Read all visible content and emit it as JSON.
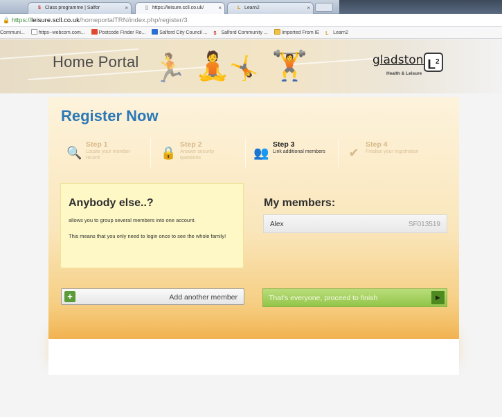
{
  "browser": {
    "tabs": [
      {
        "label": "Class programme | Salfor",
        "icon": "dollar-icon"
      },
      {
        "label": "https://leisure.scll.co.uk/",
        "icon": "page-icon",
        "active": true
      },
      {
        "label": "Learn2",
        "icon": "l2-icon"
      }
    ],
    "address": {
      "scheme": "https://",
      "host": "leisure.scll.co.uk",
      "path": "/homeportalTRN/index.php/register/3"
    },
    "bookmarks": [
      {
        "label": "Communi...",
        "icon": "page-icon"
      },
      {
        "label": "https--webcom.com...",
        "icon": "page-icon"
      },
      {
        "label": "Postcode Finder Ro...",
        "icon": "red-icon"
      },
      {
        "label": "Salford City Council ...",
        "icon": "square-icon"
      },
      {
        "label": "Salford Community ...",
        "icon": "dollar-icon"
      },
      {
        "label": "Imported From IE",
        "icon": "folder-icon"
      },
      {
        "label": "Learn2",
        "icon": "l2-icon"
      }
    ]
  },
  "header": {
    "title": "Home Portal",
    "brand": "gladstone",
    "brand_badge": "L",
    "brand_badge_sup": "2",
    "brand_tagline": "Health & Leisure"
  },
  "register": {
    "title": "Register Now",
    "steps": [
      {
        "title": "Step 1",
        "desc": "Locate your member record",
        "state": "done"
      },
      {
        "title": "Step 2",
        "desc": "Answer security questions",
        "state": "done"
      },
      {
        "title": "Step 3",
        "desc": "Link additional members",
        "state": "active"
      },
      {
        "title": "Step 4",
        "desc": "Finalise your registration",
        "state": "pending"
      }
    ],
    "info": {
      "title": "Anybody else..?",
      "p1": "allows you to group several members into one account.",
      "p2": "This means that you only need to login once to see the whole family!"
    },
    "members": {
      "title": "My members:",
      "list": [
        {
          "name": "Alex",
          "id": "SF013519"
        }
      ]
    },
    "add_button": "Add another member",
    "proceed_button": "That's everyone, proceed to finish",
    "colors": {
      "title_blue": "#2b79b6",
      "proceed_green": "#93c54a",
      "info_yellow": "#fdf8c6"
    }
  }
}
